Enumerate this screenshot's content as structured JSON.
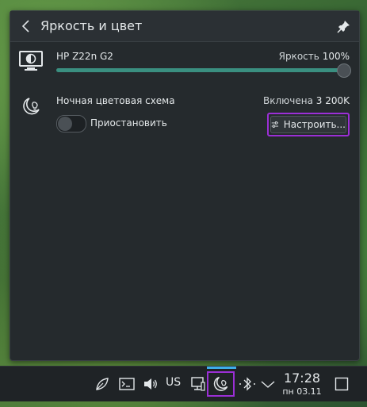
{
  "popup": {
    "title": "Яркость и цвет",
    "back_icon": "chevron-left-icon",
    "pin_icon": "pin-icon"
  },
  "display": {
    "icon": "monitor-brightness-icon",
    "name": "HP Z22n G2",
    "brightness_label": "Яркость",
    "brightness_value": "100%",
    "brightness_percent": 100
  },
  "night_color": {
    "icon": "night-color-icon",
    "title": "Ночная цветовая схема",
    "status_label": "Включена",
    "temperature": "3 200K",
    "pause_label": "Приостановить",
    "pause_enabled": false,
    "configure_label": "Настроить...",
    "configure_icon": "sliders-icon"
  },
  "taskbar": {
    "tray": [
      {
        "name": "leaf-icon"
      },
      {
        "name": "terminal-icon"
      },
      {
        "name": "volume-icon"
      },
      {
        "name": "network-icon"
      },
      {
        "name": "night-color-icon"
      },
      {
        "name": "bluetooth-icon"
      },
      {
        "name": "chevron-up-icon"
      }
    ],
    "keyboard_layout": "US",
    "clock_time": "17:28",
    "clock_date": "пн 03.11",
    "show_desktop_icon": "show-desktop-icon"
  },
  "colors": {
    "accent": "#3daee9",
    "slider_fill": "#3a8f80",
    "highlight": "#9b2fd6"
  }
}
